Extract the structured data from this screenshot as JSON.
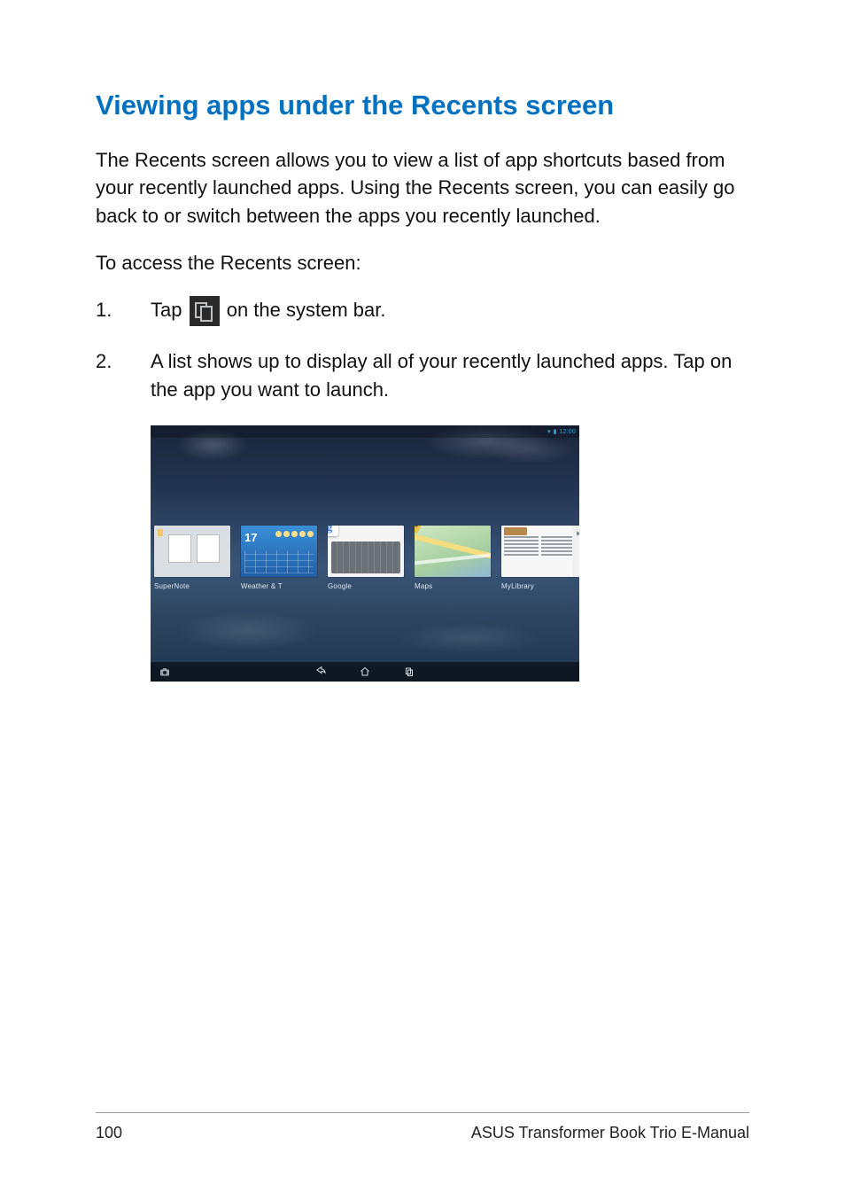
{
  "heading": "Viewing apps under the Recents screen",
  "intro": "The Recents screen allows you to view a list of app shortcuts based from your recently launched apps. Using the Recents screen, you can easily go back to or switch between the apps you recently launched.",
  "lead": "To access the Recents screen:",
  "steps": {
    "n1": "1.",
    "s1a": "Tap ",
    "s1b": " on the system bar.",
    "n2": "2.",
    "s2": "A list shows up to display all of your recently launched apps. Tap on the app you want to launch."
  },
  "screenshot": {
    "status_time": "12:00",
    "weather_temp": "17",
    "google_logo_letter": "g",
    "recents": [
      {
        "label": "SuperNote"
      },
      {
        "label": "Weather & T"
      },
      {
        "label": "Google"
      },
      {
        "label": "Maps"
      },
      {
        "label": "MyLibrary"
      }
    ]
  },
  "footer": {
    "page": "100",
    "manual": "ASUS Transformer Book Trio E-Manual"
  }
}
